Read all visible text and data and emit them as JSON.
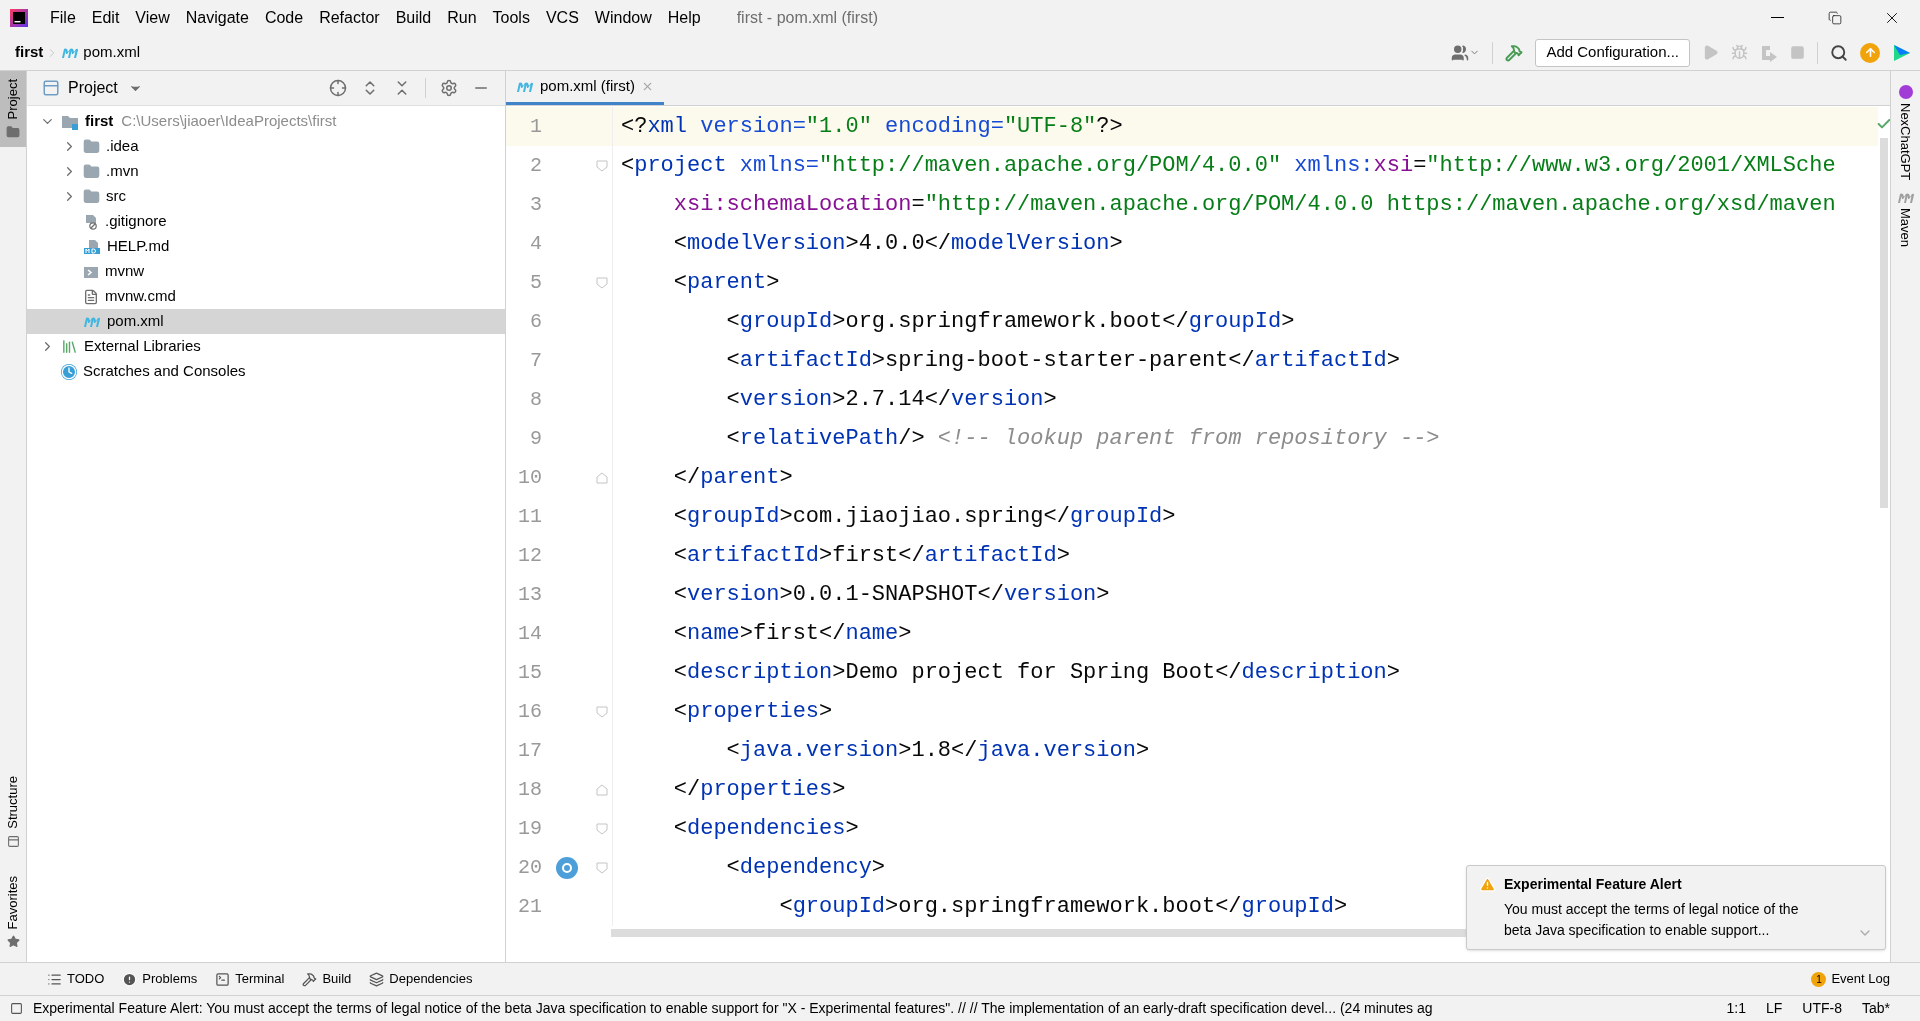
{
  "menu": [
    "File",
    "Edit",
    "View",
    "Navigate",
    "Code",
    "Refactor",
    "Build",
    "Run",
    "Tools",
    "VCS",
    "Window",
    "Help"
  ],
  "window_title": "first - pom.xml (first)",
  "breadcrumbs": [
    "first",
    "pom.xml"
  ],
  "run_config": "Add Configuration...",
  "left_strip": [
    {
      "label": "Project",
      "selected": true
    },
    {
      "label": "Structure",
      "selected": false
    },
    {
      "label": "Favorites",
      "selected": false
    }
  ],
  "project_panel": {
    "title": "Project",
    "tree": [
      {
        "label": "first",
        "path": "C:\\Users\\jiaoer\\IdeaProjects\\first",
        "kind": "module",
        "expanded": true,
        "selected": false,
        "children": [
          {
            "label": ".idea",
            "kind": "folder",
            "expanded": false,
            "selected": false
          },
          {
            "label": ".mvn",
            "kind": "folder",
            "expanded": false,
            "selected": false
          },
          {
            "label": "src",
            "kind": "folder",
            "expanded": false,
            "selected": false
          },
          {
            "label": ".gitignore",
            "kind": "ignore",
            "selected": false
          },
          {
            "label": "HELP.md",
            "kind": "markdown",
            "selected": false
          },
          {
            "label": "mvnw",
            "kind": "shell",
            "selected": false
          },
          {
            "label": "mvnw.cmd",
            "kind": "text",
            "selected": false
          },
          {
            "label": "pom.xml",
            "kind": "maven",
            "selected": true
          }
        ]
      },
      {
        "label": "External Libraries",
        "kind": "libraries",
        "expanded": false,
        "selected": false
      },
      {
        "label": "Scratches and Consoles",
        "kind": "scratches",
        "selected": false
      }
    ]
  },
  "editor": {
    "tabs": [
      {
        "label": "pom.xml (first)",
        "selected": true
      }
    ],
    "lines": [
      {
        "number": "1",
        "current": true,
        "segments": [
          {
            "kind": "punct",
            "text": "<?"
          },
          {
            "kind": "tag",
            "text": "xml"
          },
          {
            "kind": "attr",
            "text": " version="
          },
          {
            "kind": "value",
            "text": "\"1.0\""
          },
          {
            "kind": "attr",
            "text": " encoding="
          },
          {
            "kind": "value",
            "text": "\"UTF-8\""
          },
          {
            "kind": "punct",
            "text": "?>"
          }
        ]
      },
      {
        "number": "2",
        "fold_start": true,
        "segments": [
          {
            "kind": "punct",
            "text": "<"
          },
          {
            "kind": "tag",
            "text": "project"
          },
          {
            "kind": "attr",
            "text": " xmlns="
          },
          {
            "kind": "value",
            "text": "\"http://maven.apache.org/POM/4.0.0\""
          },
          {
            "kind": "attr",
            "text": " xmlns:"
          },
          {
            "kind": "ns",
            "text": "xsi"
          },
          {
            "kind": "punct",
            "text": "="
          },
          {
            "kind": "value",
            "text": "\"http://www.w3.org/2001/XMLSche"
          }
        ]
      },
      {
        "number": "3",
        "segments": [
          {
            "kind": "ns",
            "text": "    xsi:schemaLocation"
          },
          {
            "kind": "punct",
            "text": "="
          },
          {
            "kind": "value",
            "text": "\"http://maven.apache.org/POM/4.0.0 https://maven.apache.org/xsd/maven"
          }
        ]
      },
      {
        "number": "4",
        "segments": [
          {
            "kind": "punct",
            "text": "    <"
          },
          {
            "kind": "tag",
            "text": "modelVersion"
          },
          {
            "kind": "punct",
            "text": ">"
          },
          {
            "kind": "text",
            "text": "4.0.0"
          },
          {
            "kind": "punct",
            "text": "</"
          },
          {
            "kind": "tag",
            "text": "modelVersion"
          },
          {
            "kind": "punct",
            "text": ">"
          }
        ]
      },
      {
        "number": "5",
        "fold_start": true,
        "segments": [
          {
            "kind": "punct",
            "text": "    <"
          },
          {
            "kind": "tag",
            "text": "parent"
          },
          {
            "kind": "punct",
            "text": ">"
          }
        ]
      },
      {
        "number": "6",
        "segments": [
          {
            "kind": "punct",
            "text": "        <"
          },
          {
            "kind": "tag",
            "text": "groupId"
          },
          {
            "kind": "punct",
            "text": ">"
          },
          {
            "kind": "text",
            "text": "org.springframework.boot"
          },
          {
            "kind": "punct",
            "text": "</"
          },
          {
            "kind": "tag",
            "text": "groupId"
          },
          {
            "kind": "punct",
            "text": ">"
          }
        ]
      },
      {
        "number": "7",
        "segments": [
          {
            "kind": "punct",
            "text": "        <"
          },
          {
            "kind": "tag",
            "text": "artifactId"
          },
          {
            "kind": "punct",
            "text": ">"
          },
          {
            "kind": "text",
            "text": "spring-boot-starter-parent"
          },
          {
            "kind": "punct",
            "text": "</"
          },
          {
            "kind": "tag",
            "text": "artifactId"
          },
          {
            "kind": "punct",
            "text": ">"
          }
        ]
      },
      {
        "number": "8",
        "segments": [
          {
            "kind": "punct",
            "text": "        <"
          },
          {
            "kind": "tag",
            "text": "version"
          },
          {
            "kind": "punct",
            "text": ">"
          },
          {
            "kind": "text",
            "text": "2.7.14"
          },
          {
            "kind": "punct",
            "text": "</"
          },
          {
            "kind": "tag",
            "text": "version"
          },
          {
            "kind": "punct",
            "text": ">"
          }
        ]
      },
      {
        "number": "9",
        "segments": [
          {
            "kind": "punct",
            "text": "        <"
          },
          {
            "kind": "tag",
            "text": "relativePath"
          },
          {
            "kind": "punct",
            "text": "/>"
          },
          {
            "kind": "comment",
            "text": " <!-- lookup parent from repository -->"
          }
        ]
      },
      {
        "number": "10",
        "fold_end": true,
        "segments": [
          {
            "kind": "punct",
            "text": "    </"
          },
          {
            "kind": "tag",
            "text": "parent"
          },
          {
            "kind": "punct",
            "text": ">"
          }
        ]
      },
      {
        "number": "11",
        "segments": [
          {
            "kind": "punct",
            "text": "    <"
          },
          {
            "kind": "tag",
            "text": "groupId"
          },
          {
            "kind": "punct",
            "text": ">"
          },
          {
            "kind": "text",
            "text": "com.jiaojiao.spring"
          },
          {
            "kind": "punct",
            "text": "</"
          },
          {
            "kind": "tag",
            "text": "groupId"
          },
          {
            "kind": "punct",
            "text": ">"
          }
        ]
      },
      {
        "number": "12",
        "segments": [
          {
            "kind": "punct",
            "text": "    <"
          },
          {
            "kind": "tag",
            "text": "artifactId"
          },
          {
            "kind": "punct",
            "text": ">"
          },
          {
            "kind": "text",
            "text": "first"
          },
          {
            "kind": "punct",
            "text": "</"
          },
          {
            "kind": "tag",
            "text": "artifactId"
          },
          {
            "kind": "punct",
            "text": ">"
          }
        ]
      },
      {
        "number": "13",
        "segments": [
          {
            "kind": "punct",
            "text": "    <"
          },
          {
            "kind": "tag",
            "text": "version"
          },
          {
            "kind": "punct",
            "text": ">"
          },
          {
            "kind": "text",
            "text": "0.0.1-SNAPSHOT"
          },
          {
            "kind": "punct",
            "text": "</"
          },
          {
            "kind": "tag",
            "text": "version"
          },
          {
            "kind": "punct",
            "text": ">"
          }
        ]
      },
      {
        "number": "14",
        "segments": [
          {
            "kind": "punct",
            "text": "    <"
          },
          {
            "kind": "tag",
            "text": "name"
          },
          {
            "kind": "punct",
            "text": ">"
          },
          {
            "kind": "text",
            "text": "first"
          },
          {
            "kind": "punct",
            "text": "</"
          },
          {
            "kind": "tag",
            "text": "name"
          },
          {
            "kind": "punct",
            "text": ">"
          }
        ]
      },
      {
        "number": "15",
        "segments": [
          {
            "kind": "punct",
            "text": "    <"
          },
          {
            "kind": "tag",
            "text": "description"
          },
          {
            "kind": "punct",
            "text": ">"
          },
          {
            "kind": "text",
            "text": "Demo project for Spring Boot"
          },
          {
            "kind": "punct",
            "text": "</"
          },
          {
            "kind": "tag",
            "text": "description"
          },
          {
            "kind": "punct",
            "text": ">"
          }
        ]
      },
      {
        "number": "16",
        "fold_start": true,
        "segments": [
          {
            "kind": "punct",
            "text": "    <"
          },
          {
            "kind": "tag",
            "text": "properties"
          },
          {
            "kind": "punct",
            "text": ">"
          }
        ]
      },
      {
        "number": "17",
        "segments": [
          {
            "kind": "punct",
            "text": "        <"
          },
          {
            "kind": "tag",
            "text": "java.version"
          },
          {
            "kind": "punct",
            "text": ">"
          },
          {
            "kind": "text",
            "text": "1.8"
          },
          {
            "kind": "punct",
            "text": "</"
          },
          {
            "kind": "tag",
            "text": "java.version"
          },
          {
            "kind": "punct",
            "text": ">"
          }
        ]
      },
      {
        "number": "18",
        "fold_end": true,
        "segments": [
          {
            "kind": "punct",
            "text": "    </"
          },
          {
            "kind": "tag",
            "text": "properties"
          },
          {
            "kind": "punct",
            "text": ">"
          }
        ]
      },
      {
        "number": "19",
        "fold_start": true,
        "segments": [
          {
            "kind": "punct",
            "text": "    <"
          },
          {
            "kind": "tag",
            "text": "dependencies"
          },
          {
            "kind": "punct",
            "text": ">"
          }
        ]
      },
      {
        "number": "20",
        "fold_start": true,
        "marker": true,
        "segments": [
          {
            "kind": "punct",
            "text": "        <"
          },
          {
            "kind": "tag",
            "text": "dependency"
          },
          {
            "kind": "punct",
            "text": ">"
          }
        ]
      },
      {
        "number": "21",
        "segments": [
          {
            "kind": "punct",
            "text": "            <"
          },
          {
            "kind": "tag",
            "text": "groupId"
          },
          {
            "kind": "punct",
            "text": ">"
          },
          {
            "kind": "text",
            "text": "org.springframework.boot"
          },
          {
            "kind": "punct",
            "text": "</"
          },
          {
            "kind": "tag",
            "text": "groupId"
          },
          {
            "kind": "punct",
            "text": ">"
          }
        ]
      }
    ]
  },
  "right_strip": [
    "NexChatGPT",
    "Maven"
  ],
  "notification": {
    "title": "Experimental Feature Alert",
    "body": "You must accept the terms of legal notice of the beta Java specification to enable support..."
  },
  "tool_windows": [
    {
      "label": "TODO",
      "kind": "todo"
    },
    {
      "label": "Problems",
      "kind": "problems"
    },
    {
      "label": "Terminal",
      "kind": "terminal"
    },
    {
      "label": "Build",
      "kind": "build"
    },
    {
      "label": "Dependencies",
      "kind": "dependencies"
    }
  ],
  "event_log": {
    "label": "Event Log",
    "count": "1"
  },
  "status": {
    "message": "Experimental Feature Alert: You must accept the terms of legal notice of the beta Java specification to enable support for \"X - Experimental features\". // // The implementation of an early-draft specification devel... (24 minutes ag",
    "position": "1:1",
    "line_ending": "LF",
    "encoding": "UTF-8",
    "indent": "Tab*"
  }
}
